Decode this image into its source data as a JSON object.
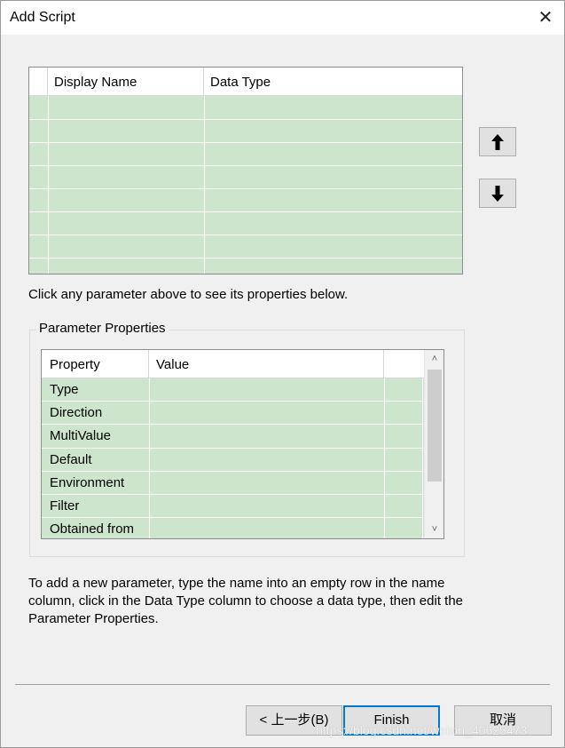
{
  "window": {
    "title": "Add Script",
    "close_glyph": "✕"
  },
  "parameters_grid": {
    "columns": [
      "Display Name",
      "Data Type"
    ],
    "rows": []
  },
  "move_up_button": {
    "icon": "arrow-up-icon"
  },
  "move_down_button": {
    "icon": "arrow-down-icon"
  },
  "hint_select": "Click any parameter above to see its properties below.",
  "parameter_properties": {
    "group_title": "Parameter Properties",
    "columns": [
      "Property",
      "Value"
    ],
    "rows": [
      {
        "property": "Type",
        "value": ""
      },
      {
        "property": "Direction",
        "value": ""
      },
      {
        "property": "MultiValue",
        "value": ""
      },
      {
        "property": "Default",
        "value": ""
      },
      {
        "property": "Environment",
        "value": ""
      },
      {
        "property": "Filter",
        "value": ""
      },
      {
        "property": "Obtained from",
        "value": ""
      }
    ],
    "scroll_up_glyph": "˄",
    "scroll_down_glyph": "˅"
  },
  "hint_add": "To add a new parameter, type the name into an empty row in the name column, click in the Data Type column to choose a data type, then edit the Parameter Properties.",
  "buttons": {
    "back": "< 上一步(B)",
    "finish": "Finish",
    "cancel": "取消"
  },
  "watermark": "https://blog.csdn.net/weixin_40625473",
  "colors": {
    "grid_row_bg": "#cce5cc",
    "default_button_border": "#0078d7"
  }
}
